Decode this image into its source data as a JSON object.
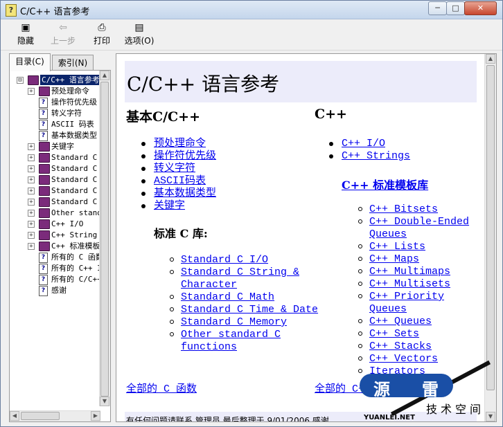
{
  "window": {
    "title": "C/C++ 语言参考",
    "min": "─",
    "max": "□",
    "close": "✕"
  },
  "toolbar": {
    "hide": "隐藏",
    "back": "上一步",
    "print": "打印",
    "options": "选项(O)"
  },
  "tabs": {
    "contents": "目录(C)",
    "index": "索引(N)"
  },
  "tree": [
    {
      "label": "C/C++ 语言参考",
      "expander": "⊟",
      "icon": "book",
      "level": 0
    },
    {
      "label": "预处理命令",
      "expander": "+",
      "icon": "book",
      "level": 1
    },
    {
      "label": "操作符优先级",
      "expander": "",
      "icon": "page",
      "level": 1
    },
    {
      "label": "转义字符",
      "expander": "",
      "icon": "page",
      "level": 1
    },
    {
      "label": "ASCII 码表",
      "expander": "",
      "icon": "page",
      "level": 1
    },
    {
      "label": "基本数据类型",
      "expander": "",
      "icon": "page",
      "level": 1
    },
    {
      "label": "关键字",
      "expander": "+",
      "icon": "book",
      "level": 1
    },
    {
      "label": "Standard C I",
      "expander": "+",
      "icon": "book",
      "level": 1
    },
    {
      "label": "Standard C S",
      "expander": "+",
      "icon": "book",
      "level": 1
    },
    {
      "label": "Standard C M",
      "expander": "+",
      "icon": "book",
      "level": 1
    },
    {
      "label": "Standard C T",
      "expander": "+",
      "icon": "book",
      "level": 1
    },
    {
      "label": "Standard C M",
      "expander": "+",
      "icon": "book",
      "level": 1
    },
    {
      "label": "Other standa",
      "expander": "+",
      "icon": "book",
      "level": 1
    },
    {
      "label": "C++ I/O",
      "expander": "+",
      "icon": "book",
      "level": 1
    },
    {
      "label": "C++ String",
      "expander": "+",
      "icon": "book",
      "level": 1
    },
    {
      "label": "C++ 标准模板",
      "expander": "+",
      "icon": "book",
      "level": 1
    },
    {
      "label": "所有的 C 函数",
      "expander": "",
      "icon": "page",
      "level": 1
    },
    {
      "label": "所有的 C++ I",
      "expander": "",
      "icon": "page",
      "level": 1
    },
    {
      "label": "所有的 C/C++",
      "expander": "",
      "icon": "page",
      "level": 1
    },
    {
      "label": "感谢",
      "expander": "",
      "icon": "page",
      "level": 1
    }
  ],
  "content": {
    "title": "C/C++ 语言参考",
    "left_heading": "基本C/C++",
    "right_heading": "C++",
    "basic_links": [
      "预处理命令",
      "操作符优先级",
      "转义字符",
      "ASCII码表",
      "基本数据类型",
      "关键字"
    ],
    "stdc_heading": "标准 C 库:",
    "stdc_links": [
      [
        "Standard C I/O"
      ],
      [
        "Standard C String &",
        "Character"
      ],
      [
        "Standard C Math"
      ],
      [
        "Standard C Time & Date"
      ],
      [
        "Standard C Memory"
      ],
      [
        "Other standard C",
        "functions"
      ]
    ],
    "cpp_links": [
      "C++ I/O",
      "C++ Strings"
    ],
    "stl_heading": "C++ 标准模板库",
    "stl_links": [
      [
        "C++ Bitsets"
      ],
      [
        "C++ Double-Ended",
        "Queues"
      ],
      [
        "C++ Lists"
      ],
      [
        "C++ Maps"
      ],
      [
        "C++ Multimaps"
      ],
      [
        "C++ Multisets"
      ],
      [
        "C++ Priority Queues"
      ],
      [
        "C++ Queues"
      ],
      [
        "C++ Sets"
      ],
      [
        "C++ Stacks"
      ],
      [
        "C++ Vectors"
      ],
      [
        "Iterators"
      ]
    ],
    "all_c_functions": "全部的 C 函数",
    "all_cpp": "全部的 C+",
    "footer": "有任何问题请联系 管理员 最后整理于 9/01/2006  感谢"
  },
  "watermark": {
    "char1": "源",
    "char2": "雷",
    "sub": "技术空间",
    "url": "YUANLEI.NET"
  }
}
